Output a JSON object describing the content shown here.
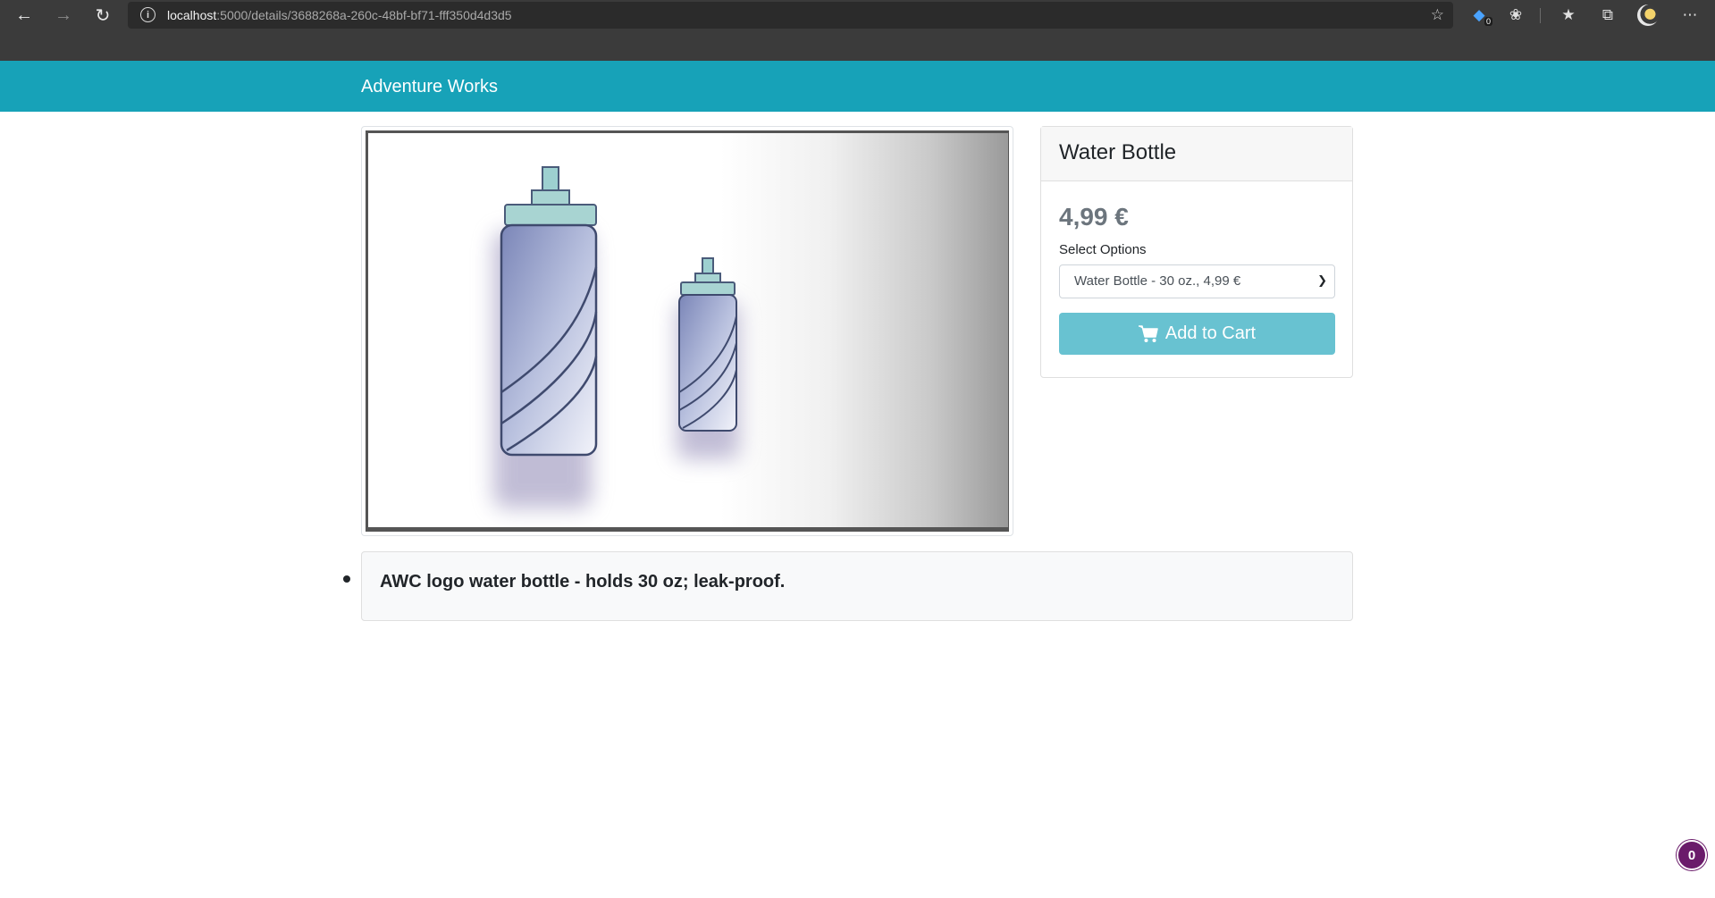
{
  "browser": {
    "url_host": "localhost",
    "url_rest": ":5000/details/3688268a-260c-48bf-bf71-fff350d4d3d5",
    "extension_badge": "0",
    "icons": [
      "back-arrow-icon",
      "forward-arrow-icon",
      "refresh-icon",
      "info-icon",
      "favorite-star-icon",
      "extension-icon",
      "extension-bug-icon",
      "favorites-icon",
      "collections-icon",
      "profile-avatar",
      "more-icon"
    ]
  },
  "navbar": {
    "brand": "Adventure Works",
    "color": "#17a2b8"
  },
  "product": {
    "image_alt": "water-bottle-image",
    "name": "Water Bottle",
    "price": "4,99 €",
    "select_label": "Select Options",
    "selected_option": "Water Bottle - 30 oz., 4,99 €",
    "add_to_cart_label": "Add to Cart",
    "button_color": "#68c2d1",
    "description": "AWC logo water bottle - holds 30 oz; leak-proof."
  },
  "floating_badge": {
    "count": "0",
    "color": "#6a1b6a"
  }
}
